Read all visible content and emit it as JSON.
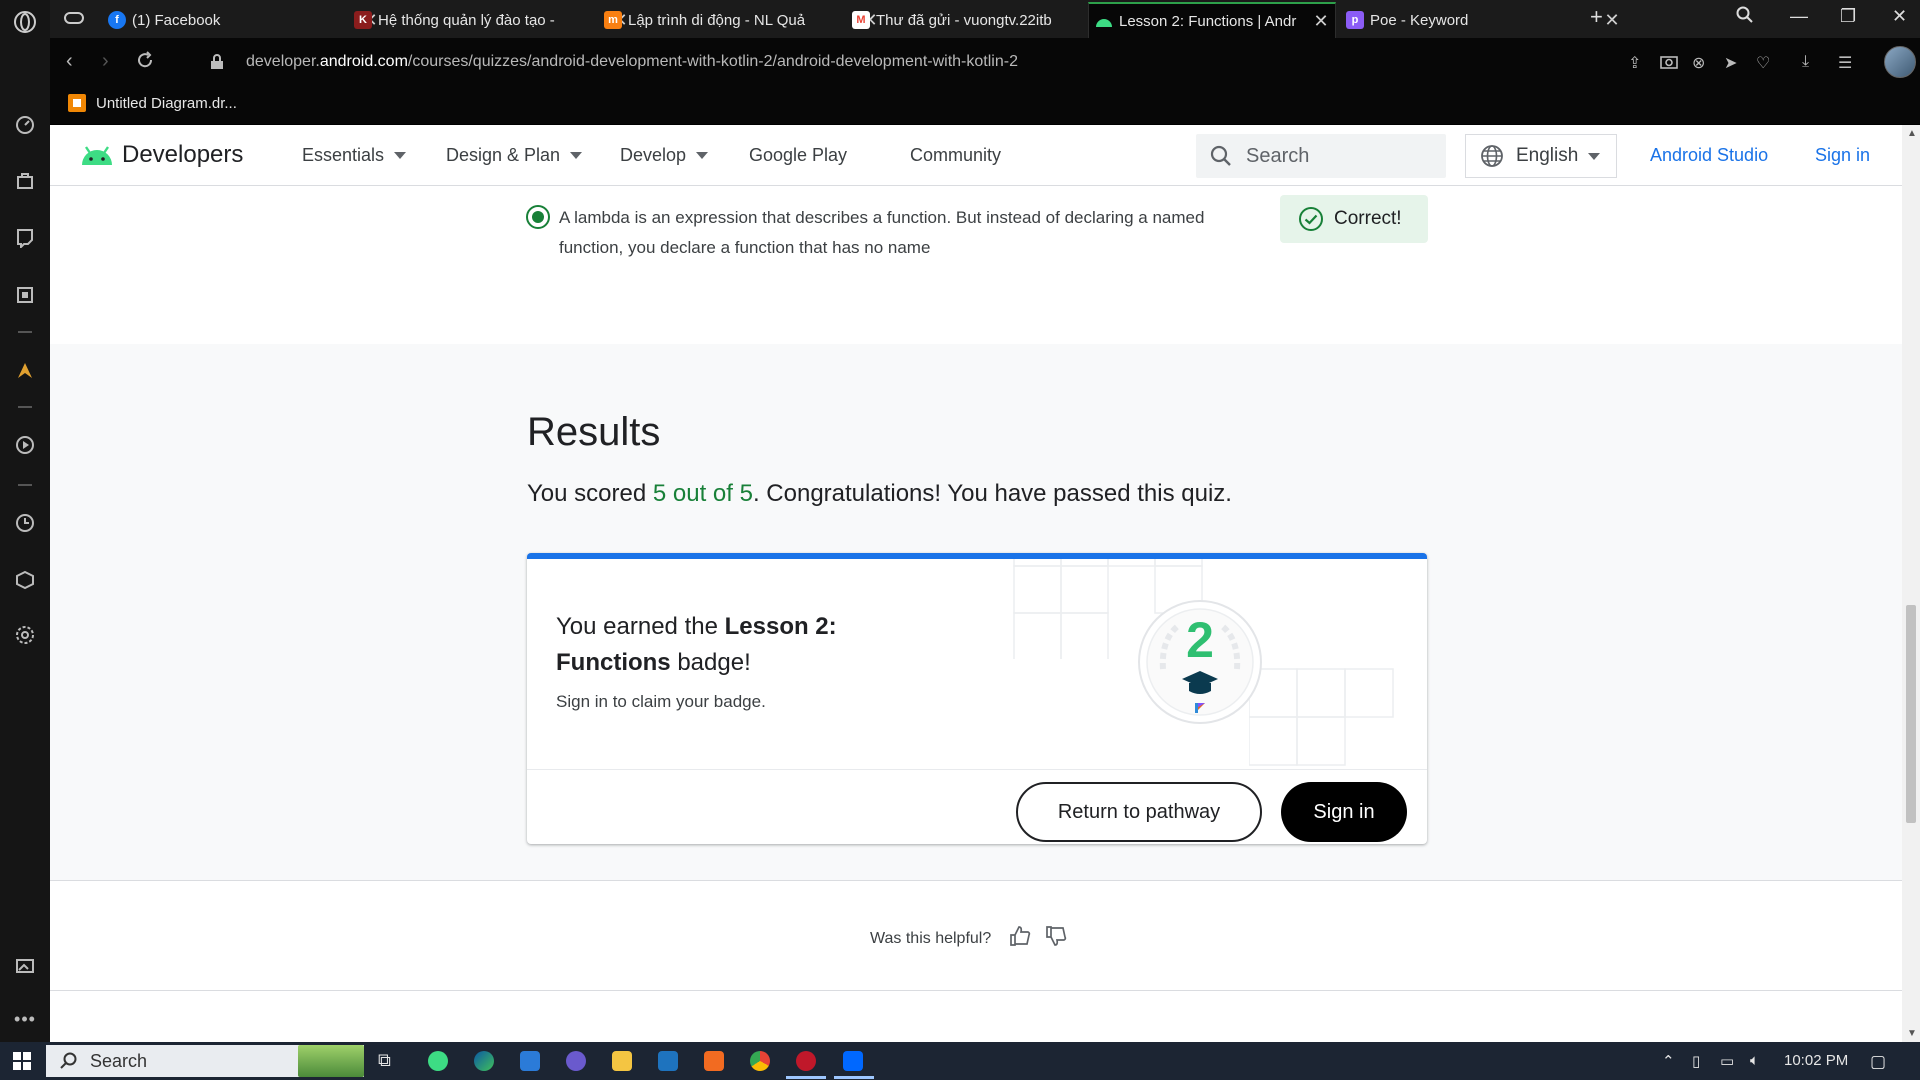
{
  "browser": {
    "tabs": [
      {
        "title": "(1) Facebook",
        "favicon": "facebook-icon",
        "color": "#1877f2",
        "active": false
      },
      {
        "title": "Hệ thống quản lý đào tạo -",
        "favicon": "university-icon",
        "color": "#c0392b",
        "active": false
      },
      {
        "title": "Lập trình di động - NL Quả",
        "favicon": "moodle-icon",
        "color": "#f98012",
        "active": false
      },
      {
        "title": "Thư đã gửi - vuongtv.22itb",
        "favicon": "gmail-icon",
        "color": "#ea4335",
        "active": false
      },
      {
        "title": "Lesson 2: Functions  |  Andr",
        "favicon": "android-icon",
        "color": "#3ddc84",
        "active": true
      },
      {
        "title": "Poe - Keyword",
        "favicon": "poe-icon",
        "color": "#8b5cf6",
        "active": false
      }
    ],
    "url_prefix": "developer.",
    "url_domain": "android.com",
    "url_path": "/courses/quizzes/android-development-with-kotlin-2/android-development-with-kotlin-2",
    "bookmark": "Untitled Diagram.dr..."
  },
  "site": {
    "brand": "Developers",
    "nav": [
      {
        "label": "Essentials",
        "dropdown": true
      },
      {
        "label": "Design & Plan",
        "dropdown": true
      },
      {
        "label": "Develop",
        "dropdown": true
      },
      {
        "label": "Google Play",
        "dropdown": false
      },
      {
        "label": "Community",
        "dropdown": false
      }
    ],
    "search_placeholder": "Search",
    "language": "English",
    "android_studio": "Android Studio",
    "sign_in": "Sign in"
  },
  "question": {
    "answer_line1": "A lambda is an expression that describes a function. But instead of declaring a named",
    "answer_line2": "function, you declare a function that has no name",
    "feedback": "Correct!"
  },
  "results": {
    "title": "Results",
    "score_prefix": "You scored ",
    "score_value": "5 out of 5",
    "score_suffix": ". Congratulations! You have passed this quiz.",
    "badge_prefix": "You earned the ",
    "badge_name": "Lesson 2: Functions",
    "badge_suffix": " badge!",
    "badge_number": "2",
    "claim_text": "Sign in to claim your badge.",
    "return_button": "Return to pathway",
    "signin_button": "Sign in"
  },
  "feedback": {
    "question": "Was this helpful?"
  },
  "taskbar": {
    "search": "Search",
    "time": "10:02 PM"
  },
  "colors": {
    "success_green": "#188038",
    "link_blue": "#1a73e8",
    "card_accent": "#1a73e8",
    "android_green": "#3ddc84"
  }
}
